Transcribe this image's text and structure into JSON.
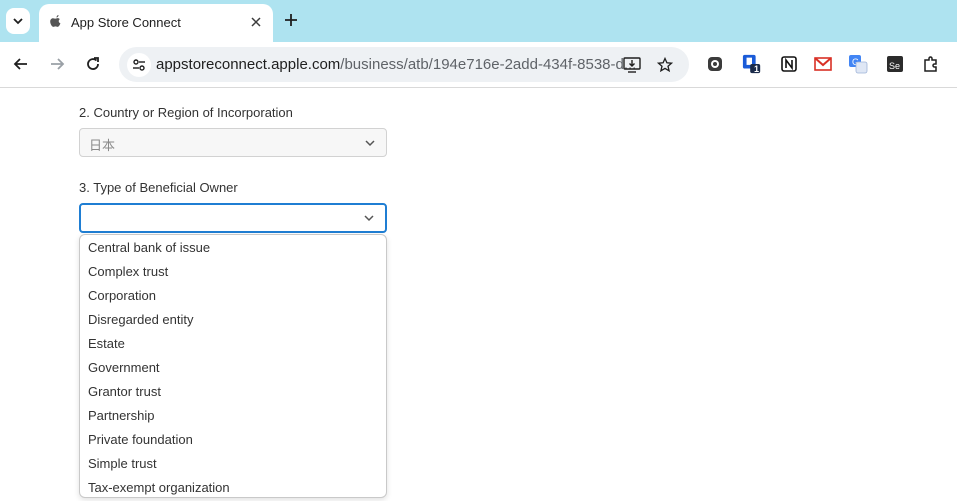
{
  "tab": {
    "title": "App Store Connect"
  },
  "omnibox": {
    "url_host": "appstoreconnect.apple.com",
    "url_path": "/business/atb/194e716e-2add-434f-8538-d..."
  },
  "extensions": {
    "badge_count": "1"
  },
  "form": {
    "country": {
      "label": "2. Country or Region of Incorporation",
      "value": "日本"
    },
    "owner_type": {
      "label": "3. Type of Beneficial Owner",
      "value": "",
      "options": [
        "Central bank of issue",
        "Complex trust",
        "Corporation",
        "Disregarded entity",
        "Estate",
        "Government",
        "Grantor trust",
        "Partnership",
        "Private foundation",
        "Simple trust",
        "Tax-exempt organization"
      ]
    }
  },
  "colors": {
    "tabstrip": "#aee3f0",
    "focus": "#1f7ed3"
  }
}
